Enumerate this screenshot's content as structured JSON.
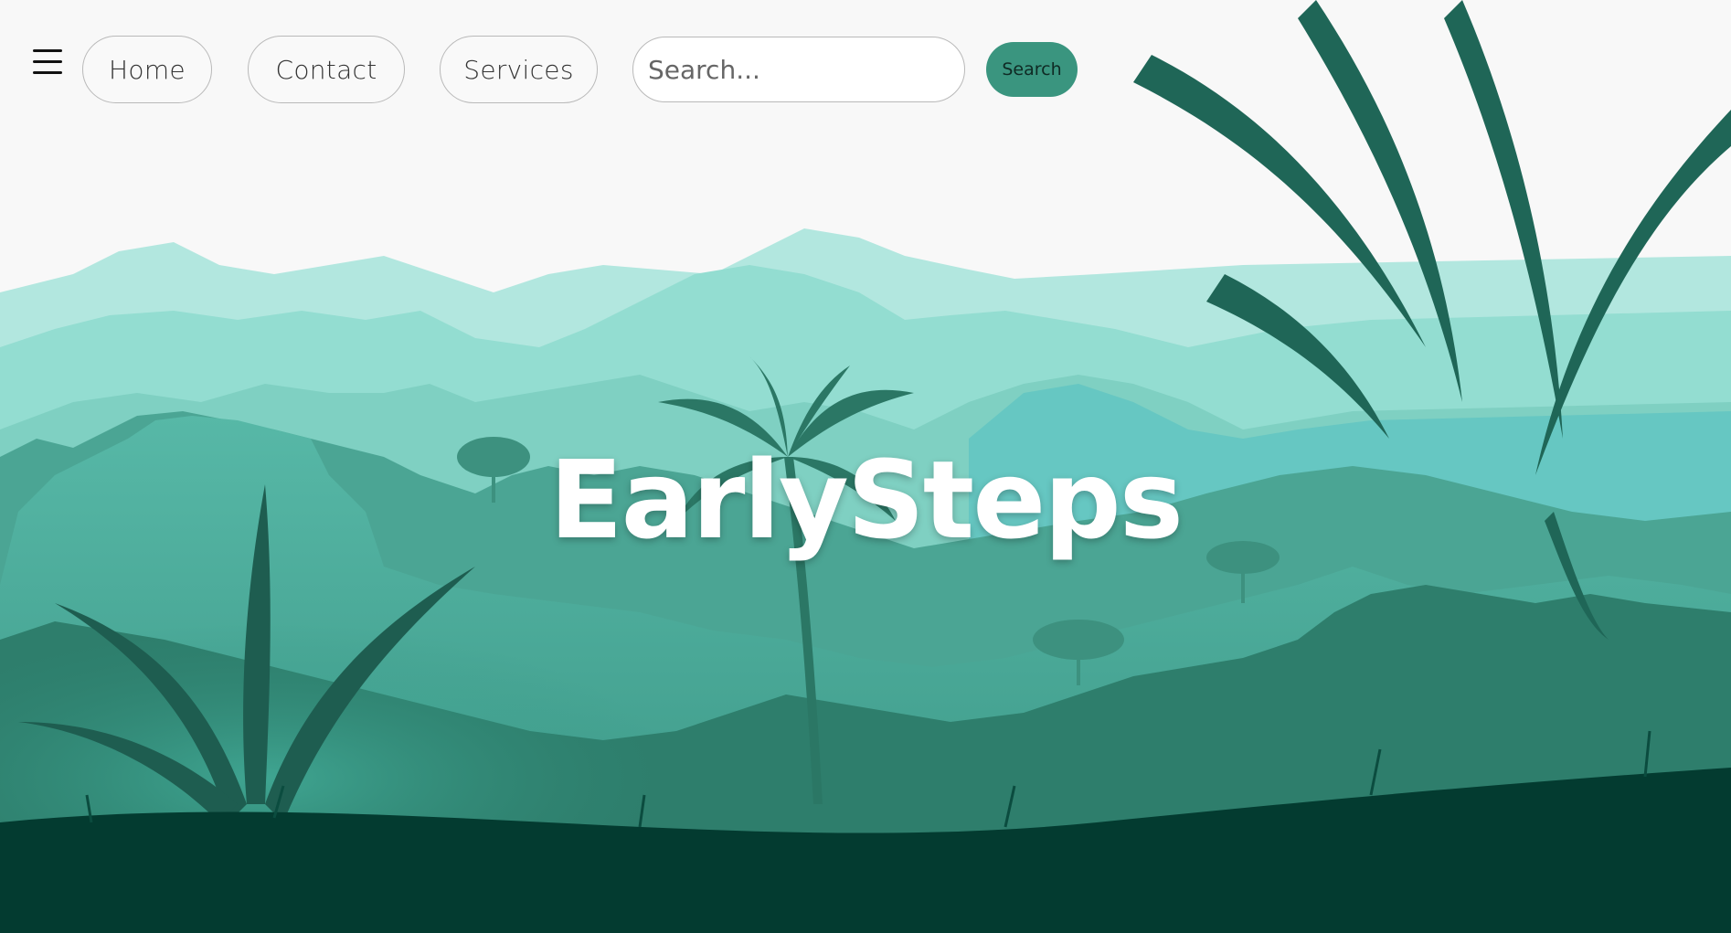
{
  "nav": {
    "menu_icon": "hamburger-icon",
    "links": [
      {
        "label": "Home"
      },
      {
        "label": "Contact"
      },
      {
        "label": "Services"
      }
    ],
    "search": {
      "placeholder": "Search...",
      "button_label": "Search"
    }
  },
  "hero": {
    "title": "EarlySteps"
  },
  "colors": {
    "accent": "#3a957f",
    "sky": "#f8f8f8",
    "foreground": "#033b30"
  }
}
